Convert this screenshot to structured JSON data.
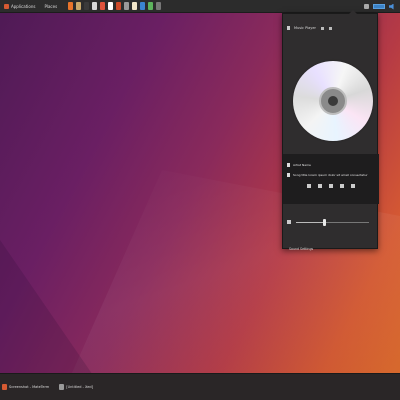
{
  "top_panel": {
    "applications_label": "Applications",
    "places_label": "Places",
    "launchers": [
      {
        "name": "launcher-firefox",
        "color": "#e8742b"
      },
      {
        "name": "launcher-files",
        "color": "#c9a86b"
      },
      {
        "name": "launcher-terminal",
        "color": "#3a3a3a"
      },
      {
        "name": "launcher-libreoffice",
        "color": "#d8d8d8"
      },
      {
        "name": "launcher-help",
        "color": "#e0533d"
      },
      {
        "name": "launcher-calculator",
        "color": "#ffffff"
      },
      {
        "name": "launcher-software",
        "color": "#cc4a2a"
      },
      {
        "name": "launcher-settings",
        "color": "#9a9a9a"
      },
      {
        "name": "launcher-store",
        "color": "#f2e6c8"
      },
      {
        "name": "launcher-mail",
        "color": "#3a84d0"
      },
      {
        "name": "launcher-image",
        "color": "#5db35d"
      },
      {
        "name": "launcher-media",
        "color": "#777777"
      }
    ],
    "tray_icons": [
      "network-icon",
      "sound-icon",
      "indicator-icon"
    ]
  },
  "sound_popup": {
    "player_title": "Music Player",
    "track_lines": [
      "Artist Name",
      "Song title lorem ipsum dolor sit amet consectetur"
    ],
    "sound_settings_label": "Sound Settings",
    "volume_fraction": 0.38
  },
  "taskbar": {
    "items": [
      {
        "label": "Screenshot - MateTerm",
        "icon_color": "#d65a32"
      },
      {
        "label": "[Untitled - Xed]",
        "icon_color": "#9a9a9a"
      }
    ]
  },
  "colors": {
    "accent": "#d65a32",
    "panel_bg": "#2c2c2c",
    "popup_bg": "#2f2d2e"
  }
}
